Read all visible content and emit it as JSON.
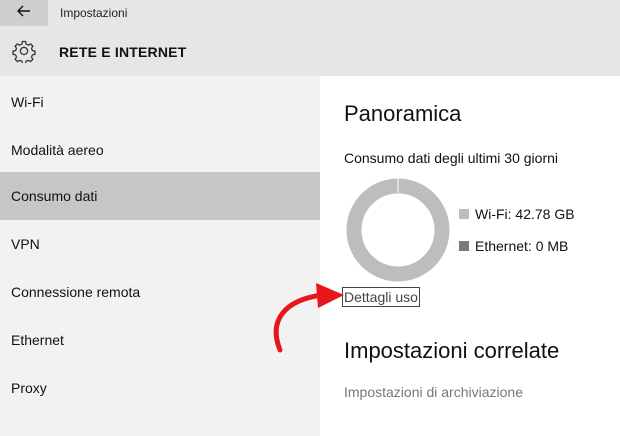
{
  "window": {
    "title": "Impostazioni"
  },
  "header": {
    "title": "RETE E INTERNET",
    "icon": "gear-icon"
  },
  "sidebar": {
    "items": [
      {
        "label": "Wi-Fi",
        "selected": false
      },
      {
        "label": "Modalità aereo",
        "selected": false
      },
      {
        "label": "Consumo dati",
        "selected": true
      },
      {
        "label": "VPN",
        "selected": false
      },
      {
        "label": "Connessione remota",
        "selected": false
      },
      {
        "label": "Ethernet",
        "selected": false
      },
      {
        "label": "Proxy",
        "selected": false
      }
    ]
  },
  "main": {
    "overview_title": "Panoramica",
    "usage_subtitle": "Consumo dati degli ultimi 30 giorni",
    "legend": [
      {
        "label": "Wi-Fi: 42.78 GB",
        "color": "#bdbdbd"
      },
      {
        "label": "Ethernet: 0 MB",
        "color": "#7a7a7a"
      }
    ],
    "details_link": "Dettagli uso",
    "related_title": "Impostazioni correlate",
    "storage_link": "Impostazioni di archiviazione"
  },
  "colors": {
    "selected_bg": "#c6c6c6",
    "sidebar_bg": "#f2f2f2",
    "header_bg": "#e6e6e6",
    "annotation_arrow": "#e8151b"
  }
}
